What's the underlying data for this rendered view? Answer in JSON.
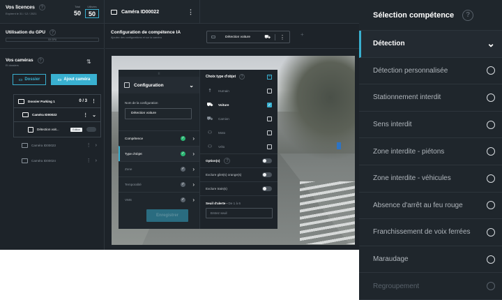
{
  "licences": {
    "title": "Vos licences",
    "subtitle": "Expirent le 31 / 12 / 2021",
    "total_label": "Total",
    "active_label": "Utilisées",
    "total": "50",
    "active": "50"
  },
  "camera_title": "Caméra ID00022",
  "gpu": {
    "title": "Utilisation du GPU",
    "bar_text": "XX GPU"
  },
  "cameras": {
    "title": "Vos caméras",
    "subtitle": "Et dossiers",
    "folder_button": "Dossier",
    "add_camera_button": "Ajout caméra",
    "tree": [
      {
        "label": "Dossier Parking 1",
        "count": "0 / 3"
      },
      {
        "label": "Caméra ID00022"
      },
      {
        "label": "Détection voit...",
        "badge": "Edition"
      },
      {
        "label": "Caméra ID00023"
      },
      {
        "label": "Caméra ID00024"
      }
    ]
  },
  "config_header": {
    "title": "Configuration de compétence IA",
    "subtitle": "Ajoutez des configurations et sur la caméra",
    "selected": "Détection voiture"
  },
  "config_panel": {
    "top_label": "|||",
    "title": "Configuration",
    "name_label": "Nom de la configuration",
    "name_value": "Détection voiture",
    "items": [
      {
        "label": "Compétence"
      },
      {
        "label": "Type d'objet"
      },
      {
        "label": "Zone"
      },
      {
        "label": "Temporalité"
      },
      {
        "label": "VMS"
      }
    ],
    "save_button": "Enregistrer"
  },
  "object_panel": {
    "title": "Choix type d'objet",
    "objects": [
      {
        "label": "Humain",
        "icon": "person-icon",
        "checked": false
      },
      {
        "label": "Voiture",
        "icon": "car-icon",
        "checked": true
      },
      {
        "label": "Camion",
        "icon": "truck-icon",
        "checked": false
      },
      {
        "label": "Moto",
        "icon": "motorbike-icon",
        "checked": false
      },
      {
        "label": "Vélo",
        "icon": "bicycle-icon",
        "checked": false
      }
    ],
    "options_title": "Option(s)",
    "options": [
      "Exclure gilet(s) orange(s)",
      "Exclure train(s)"
    ],
    "threshold_label": "Seuil d'alerte",
    "threshold_hint": "De 1 à 6",
    "threshold_placeholder": "Entrez seuil"
  },
  "right_panel": {
    "title": "Sélection compétence",
    "items": [
      {
        "label": "Détection",
        "state": "active"
      },
      {
        "label": "Détection personnalisée",
        "state": "normal"
      },
      {
        "label": "Stationnement interdit",
        "state": "normal"
      },
      {
        "label": "Sens interdit",
        "state": "normal"
      },
      {
        "label": "Zone interdite - piétons",
        "state": "normal"
      },
      {
        "label": "Zone interdite - véhicules",
        "state": "normal"
      },
      {
        "label": "Absence d'arrêt au feu rouge",
        "state": "normal"
      },
      {
        "label": "Franchissement de voix ferrées",
        "state": "normal"
      },
      {
        "label": "Maraudage",
        "state": "normal"
      },
      {
        "label": "Regroupement",
        "state": "dim"
      }
    ]
  },
  "colors": {
    "accent": "#39b0d0",
    "success": "#2bb673",
    "background": "#1d2329"
  }
}
